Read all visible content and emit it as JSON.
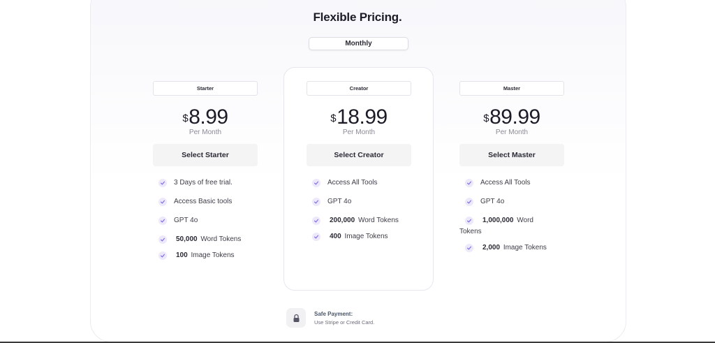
{
  "header": {
    "title": "Flexible Pricing.",
    "billing_toggle": "Monthly"
  },
  "plans": [
    {
      "name": "Starter",
      "currency": "$",
      "price": "8.99",
      "period": "Per Month",
      "button": "Select Starter",
      "features": [
        {
          "bold": "",
          "text": "3 Days of free trial."
        },
        {
          "bold": "",
          "text": "Access Basic tools"
        },
        {
          "bold": "",
          "text": "GPT 4o"
        },
        {
          "bold": "50,000",
          "text": "Word Tokens"
        },
        {
          "bold": "100",
          "text": "Image Tokens"
        }
      ]
    },
    {
      "name": "Creator",
      "currency": "$",
      "price": "18.99",
      "period": "Per Month",
      "button": "Select Creator",
      "features": [
        {
          "bold": "",
          "text": "Access All Tools"
        },
        {
          "bold": "",
          "text": "GPT 4o"
        },
        {
          "bold": "200,000",
          "text": "Word Tokens"
        },
        {
          "bold": "400",
          "text": "Image Tokens"
        }
      ]
    },
    {
      "name": "Master",
      "currency": "$",
      "price": "89.99",
      "period": "Per Month",
      "button": "Select Master",
      "features": [
        {
          "bold": "",
          "text": "Access All Tools"
        },
        {
          "bold": "",
          "text": "GPT 4o"
        },
        {
          "bold": "1,000,000",
          "text": "Word",
          "text2": "Tokens"
        },
        {
          "bold": "2,000",
          "text": "Image Tokens"
        }
      ]
    }
  ],
  "footer": {
    "safe_title": "Safe Payment:",
    "safe_sub": "Use Stripe or Credit Card.",
    "icon": "lock-icon"
  },
  "colors": {
    "accent": "#7c6ee6",
    "check_bg": "#ede9fb",
    "button_bg": "#f4f4f5"
  }
}
